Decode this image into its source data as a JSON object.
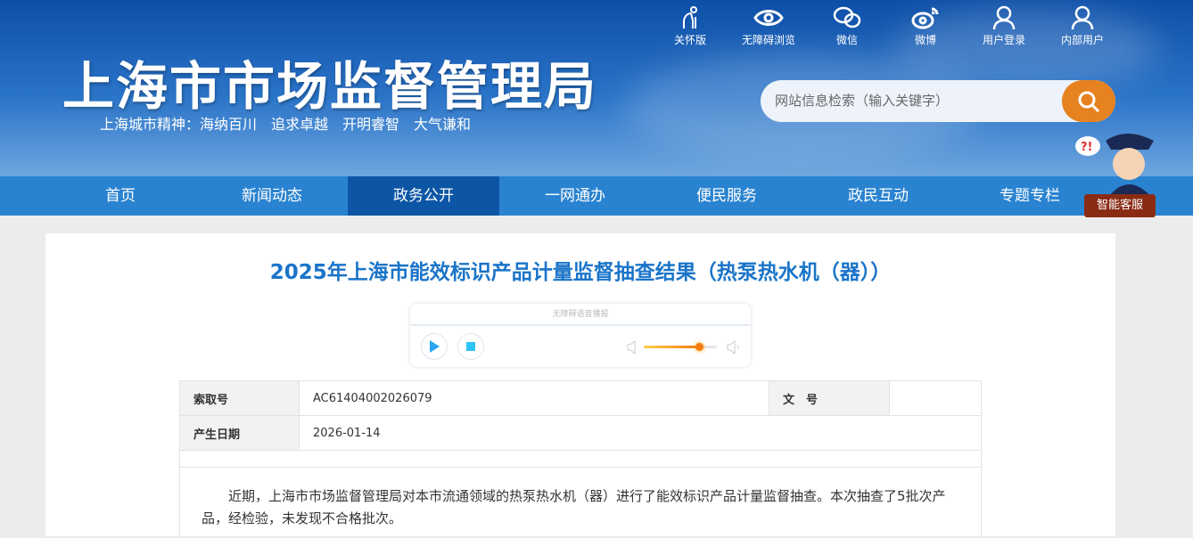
{
  "header": {
    "logo": "上海市市场监督管理局",
    "slogan": "上海城市精神：海纳百川　追求卓越　开明睿智　大气谦和",
    "top_links": [
      {
        "label": "关怀版",
        "icon": "elderly-icon"
      },
      {
        "label": "无障碍浏览",
        "icon": "eye-icon"
      },
      {
        "label": "微信",
        "icon": "wechat-icon"
      },
      {
        "label": "微博",
        "icon": "weibo-icon"
      },
      {
        "label": "用户登录",
        "icon": "user-icon"
      },
      {
        "label": "内部用户",
        "icon": "user-icon"
      }
    ],
    "search_placeholder": "网站信息检索（输入关键字）",
    "assistant_label": "智能客服"
  },
  "nav": {
    "items": [
      "首页",
      "新闻动态",
      "政务公开",
      "一网通办",
      "便民服务",
      "政民互动",
      "专题专栏"
    ],
    "active": "政务公开"
  },
  "article": {
    "title": "2025年上海市能效标识产品计量监督抽查结果（热泵热水机（器））",
    "player": {
      "label": "无障碍语音播报",
      "volume_percent": 75
    },
    "meta": {
      "index_label": "索取号",
      "index_value": "AC61404002026079",
      "doc_label": "文　号",
      "doc_value": "",
      "date_label": "产生日期",
      "date_value": "2026-01-14"
    },
    "body": "近期，上海市市场监督管理局对本市流通领域的热泵热水机（器）进行了能效标识产品计量监督抽查。本次抽查了5批次产品，经检验，未发现不合格批次。"
  }
}
